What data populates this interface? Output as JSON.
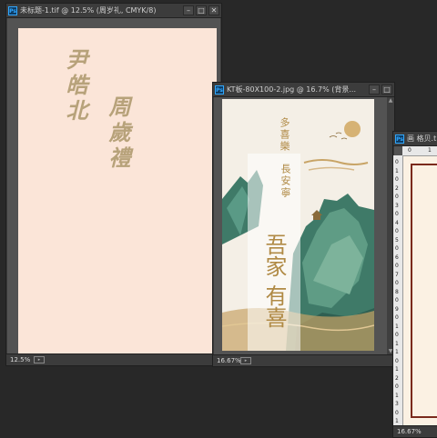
{
  "windows": [
    {
      "title": "未标题-1.tif @ 12.5% (周岁礼, CMYK/8)",
      "zoom": "12.5%",
      "ps_label": "Ps"
    },
    {
      "title": "KT板-80X100-2.jpg @ 16.7% (背景...",
      "zoom": "16.67%",
      "ps_label": "Ps"
    },
    {
      "title": "画 格贝.tif",
      "zoom": "16.67%",
      "ps_label": "Ps"
    }
  ],
  "canvas1": {
    "name_line1": "尹皓北",
    "name_line2": "周歲禮"
  },
  "canvas2": {
    "top_col1": "多喜樂",
    "top_col2": "長安寧",
    "big_col1": "吾家",
    "big_col2": "有喜"
  },
  "canvas3": {
    "ruler_left_numbers": [
      "0",
      "1",
      "0",
      "2",
      "0",
      "3",
      "0",
      "4",
      "0",
      "5",
      "0",
      "6",
      "0",
      "7",
      "0",
      "8",
      "0",
      "9",
      "0",
      "1",
      "0",
      "1",
      "1",
      "0",
      "1",
      "2",
      "0",
      "1",
      "3",
      "0",
      "1"
    ],
    "ruler_top_numbers": [
      "0",
      "1"
    ]
  },
  "controls": {
    "minimize": "–",
    "maximize": "□",
    "close": "✕"
  },
  "colors": {
    "workspace": "#282828",
    "canvas1_bg": "#fbe5d8",
    "canvas1_text": "#b7a27a",
    "canvas2_bg": "#f4efe6",
    "gold": "#b08a45",
    "mountain_green": "#3f7a68"
  }
}
